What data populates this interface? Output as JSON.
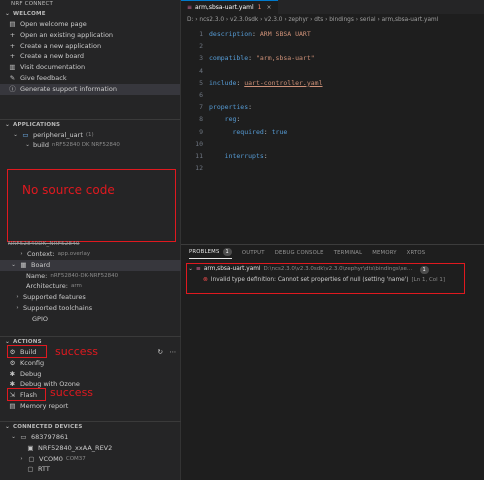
{
  "sidebar": {
    "header": "NRF CONNECT",
    "welcome": {
      "title": "WELCOME",
      "items": [
        {
          "icon": "document-icon",
          "label": "Open welcome page"
        },
        {
          "icon": "plus-icon",
          "label": "Open an existing application"
        },
        {
          "icon": "plus-icon",
          "label": "Create a new application"
        },
        {
          "icon": "plus-icon",
          "label": "Create a new board"
        },
        {
          "icon": "book-icon",
          "label": "Visit documentation"
        },
        {
          "icon": "feedback-icon",
          "label": "Give feedback"
        },
        {
          "icon": "info-icon",
          "label": "Generate support information"
        }
      ]
    },
    "applications": {
      "title": "APPLICATIONS",
      "app_name": "peripheral_uart",
      "app_count": "(1)",
      "build_label": "build",
      "build_board": "nRF52840 DK NRF52840"
    },
    "annotation_no_source": "No source code",
    "context_header": "NRF52840DK_NRF52840",
    "context": {
      "label": "Context:",
      "value": "app.overlay"
    },
    "board": {
      "label": "Board",
      "name_label": "Name:",
      "name_value": "nRF52840-DK-NRF52840",
      "arch_label": "Architecture:",
      "arch_value": "arm",
      "supported_features": "Supported features",
      "supported_toolchains": "Supported toolchains",
      "gpio": "GPIO"
    },
    "actions": {
      "title": "ACTIONS",
      "items": [
        {
          "icon": "gear-icon",
          "label": "Build"
        },
        {
          "icon": "gear-icon",
          "label": "Kconfig"
        },
        {
          "icon": "bug-icon",
          "label": "Debug"
        },
        {
          "icon": "bug-icon",
          "label": "Debug with Ozone"
        },
        {
          "icon": "flash-icon",
          "label": "Flash"
        },
        {
          "icon": "memory-icon",
          "label": "Memory report"
        }
      ],
      "annotation_build": "success",
      "annotation_flash": "success"
    },
    "devices": {
      "title": "CONNECTED DEVICES",
      "serial": "683797861",
      "items": [
        {
          "label": "NRF52840_xxAA_REV2",
          "detail": ""
        },
        {
          "label": "VCOM0",
          "detail": "COM37"
        },
        {
          "label": "RTT",
          "detail": ""
        }
      ]
    }
  },
  "editor": {
    "tab_label": "arm,sbsa-uart.yaml",
    "tab_count": "1",
    "breadcrumb": "D: › ncs2.3.0 › v2.3.0sdk › v2.3.0 › zephyr › dts › bindings › serial › arm,sbsa-uart.yaml",
    "lines": [
      {
        "n": "1",
        "key": "description",
        "val": "ARM SBSA UART"
      },
      {
        "n": "2",
        "key": "",
        "val": ""
      },
      {
        "n": "3",
        "key": "compatible",
        "val": "\"arm,sbsa-uart\""
      },
      {
        "n": "4",
        "key": "",
        "val": ""
      },
      {
        "n": "5",
        "key": "include",
        "val": "uart-controller.yaml"
      },
      {
        "n": "6",
        "key": "",
        "val": ""
      },
      {
        "n": "7",
        "key": "properties",
        "val": ""
      },
      {
        "n": "8",
        "key": "reg",
        "val": ""
      },
      {
        "n": "9",
        "key": "required",
        "val": "true"
      },
      {
        "n": "10",
        "key": "",
        "val": ""
      },
      {
        "n": "11",
        "key": "interrupts",
        "val": ""
      },
      {
        "n": "12",
        "key": "",
        "val": ""
      }
    ]
  },
  "panel": {
    "tabs": [
      "PROBLEMS",
      "OUTPUT",
      "DEBUG CONSOLE",
      "TERMINAL",
      "MEMORY",
      "XRTOS"
    ],
    "problems_count": "1",
    "file_name": "arm,sbsa-uart.yaml",
    "file_path": "D:\\ncs2.3.0\\v2.3.0sdk\\v2.3.0\\zephyr\\dts\\bindings\\serial",
    "file_count": "1",
    "error_message": "Invalid type definition: Cannot set properties of null (setting 'name')",
    "error_location": "[Ln 1, Col 1]"
  },
  "colors": {
    "annotation_red": "#e0191f",
    "accent": "#007acc",
    "error": "#f14c4c"
  }
}
